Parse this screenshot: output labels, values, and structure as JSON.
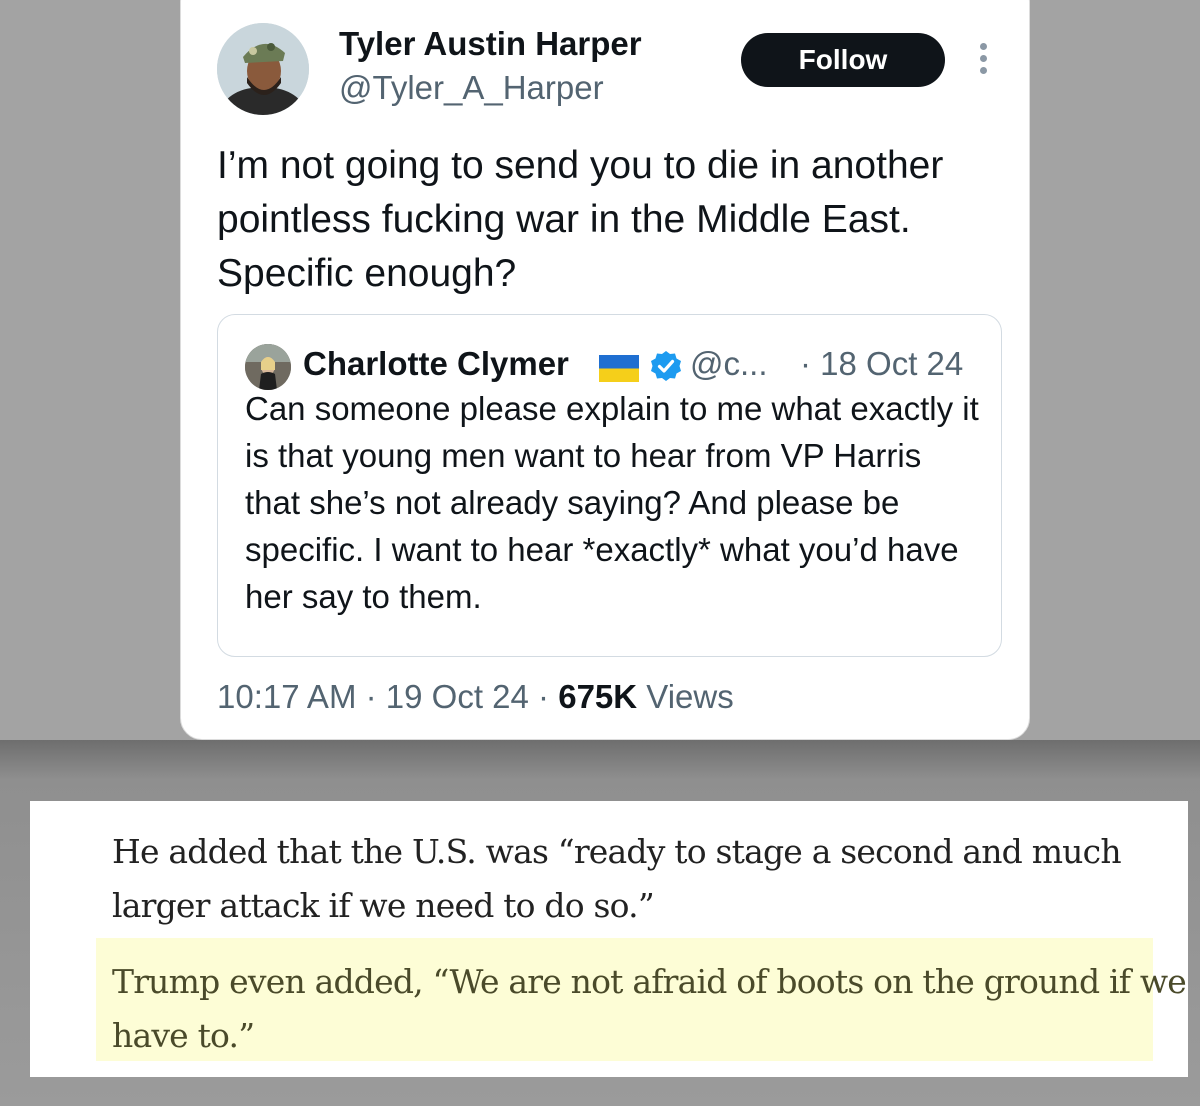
{
  "tweet": {
    "author_name": "Tyler Austin Harper",
    "author_handle": "@Tyler_A_Harper",
    "follow_label": "Follow",
    "text": "I’m not going to send you to die in another pointless fucking war in the Middle East. Specific enough?",
    "quoted": {
      "author_name": "Charlotte Clymer",
      "author_handle": "@c...",
      "date": "· 18 Oct 24",
      "text": "Can someone please explain to me what exactly it is that young men want to hear from VP Harris that she’s not already saying? And please be specific. I want to hear *exactly* what you’d have her say to them."
    },
    "time": "10:17 AM",
    "date": "19 Oct 24",
    "views_count": "675K",
    "views_label": "Views",
    "separator": "·"
  },
  "article": {
    "paragraph": "He added that the U.S. was “ready to stage a second and much larger attack if we need to do so.”",
    "highlighted_paragraph": "Trump even added, “We are not afraid of boots on the ground if we have to.”"
  },
  "icons": {
    "more": "more-vertical-icon",
    "verified": "verified-badge-icon",
    "flag": "ukraine-flag-icon"
  },
  "colors": {
    "follow_bg": "#0f1419",
    "verified": "#1d9bf0",
    "highlight": "#fdfdd6"
  }
}
